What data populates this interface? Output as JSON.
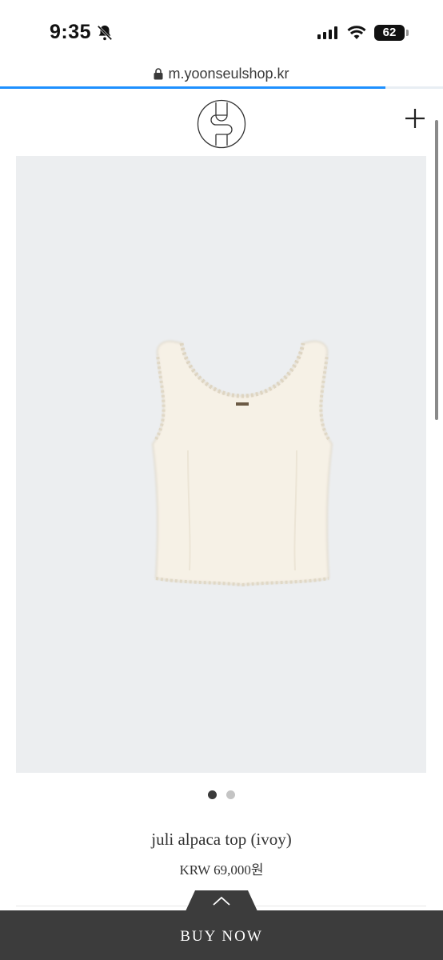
{
  "status_bar": {
    "time": "9:35",
    "battery": "62",
    "icons": [
      "bell-slash-icon",
      "signal-icon",
      "wifi-icon",
      "battery-icon"
    ]
  },
  "browser": {
    "url": "m.yoonseulshop.kr",
    "load_progress_percent": 87
  },
  "header": {
    "logo_icon": "brand-monogram-icon",
    "menu_icon": "plus-icon"
  },
  "gallery": {
    "image_description_icon": "product-photo-tank-top",
    "slide_count": 2,
    "active_slide": 1
  },
  "product": {
    "name": "juli alpaca top (ivoy)",
    "price": "KRW 69,000원"
  },
  "buy_bar": {
    "label": "BUY NOW",
    "expand_icon": "chevron-up-icon"
  },
  "colors": {
    "accent": "#1e90ff",
    "buy_bar": "#3c3c3c",
    "image_bg": "#eceef0"
  }
}
